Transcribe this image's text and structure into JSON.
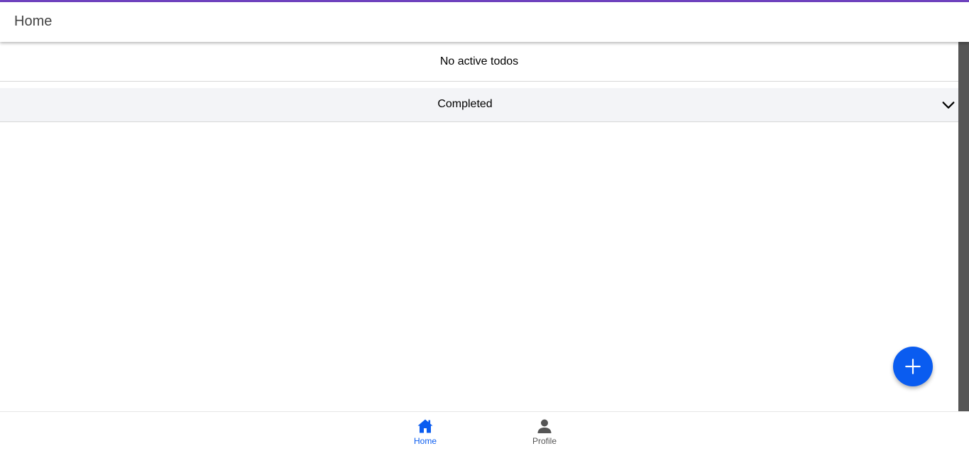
{
  "header": {
    "title": "Home"
  },
  "todos": {
    "empty_message": "No active todos"
  },
  "completed_section": {
    "label": "Completed",
    "expanded": false
  },
  "fab": {
    "icon": "plus-icon",
    "color": "#0a5cf0"
  },
  "bottom_nav": {
    "active_color": "#0a5cf0",
    "inactive_color": "#555555",
    "items": [
      {
        "label": "Home",
        "icon": "home-icon",
        "active": true
      },
      {
        "label": "Profile",
        "icon": "person-icon",
        "active": false
      }
    ]
  },
  "theme": {
    "accent": "#6f42c1"
  }
}
